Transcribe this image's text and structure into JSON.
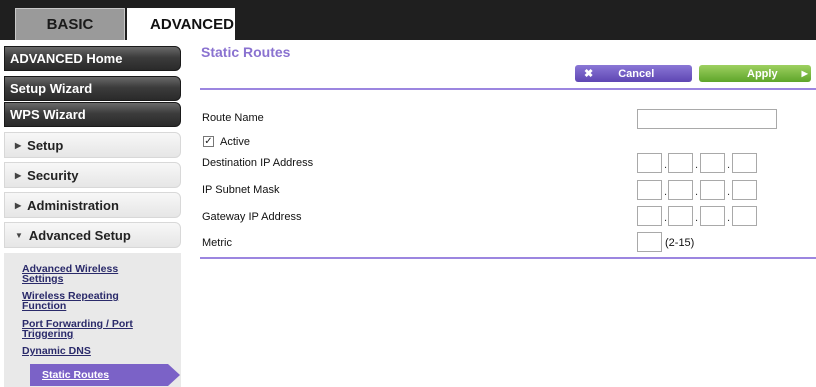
{
  "tabs": {
    "basic": "BASIC",
    "advanced": "ADVANCED"
  },
  "sidebar": {
    "advanced_home": "ADVANCED Home",
    "setup_wizard": "Setup Wizard",
    "wps_wizard": "WPS Wizard",
    "setup": "Setup",
    "security": "Security",
    "administration": "Administration",
    "advanced_setup": "Advanced Setup",
    "sub_items": [
      {
        "line1": "Advanced Wireless",
        "line2": "Settings"
      },
      {
        "line1": "Wireless Repeating",
        "line2": "Function"
      },
      {
        "line1": "Port Forwarding / Port",
        "line2": "Triggering"
      },
      {
        "line1": "Dynamic DNS",
        "line2": ""
      },
      {
        "line1": "Static Routes",
        "line2": ""
      }
    ],
    "active_item": "Static Routes"
  },
  "main": {
    "title": "Static Routes",
    "cancel_label": "Cancel",
    "apply_label": "Apply",
    "cancel_icon": "x-icon",
    "apply_icon": "play-arrow-icon",
    "accent_color": "#7b62c7",
    "apply_color": "#6fb83a"
  },
  "form": {
    "route_name_label": "Route Name",
    "route_name_value": "",
    "active_label": "Active",
    "active_checked": true,
    "destination_label": "Destination IP Address",
    "subnet_label": "IP Subnet Mask",
    "gateway_label": "Gateway IP Address",
    "metric_label": "Metric",
    "metric_range": "(2-15)",
    "metric_value": ""
  }
}
